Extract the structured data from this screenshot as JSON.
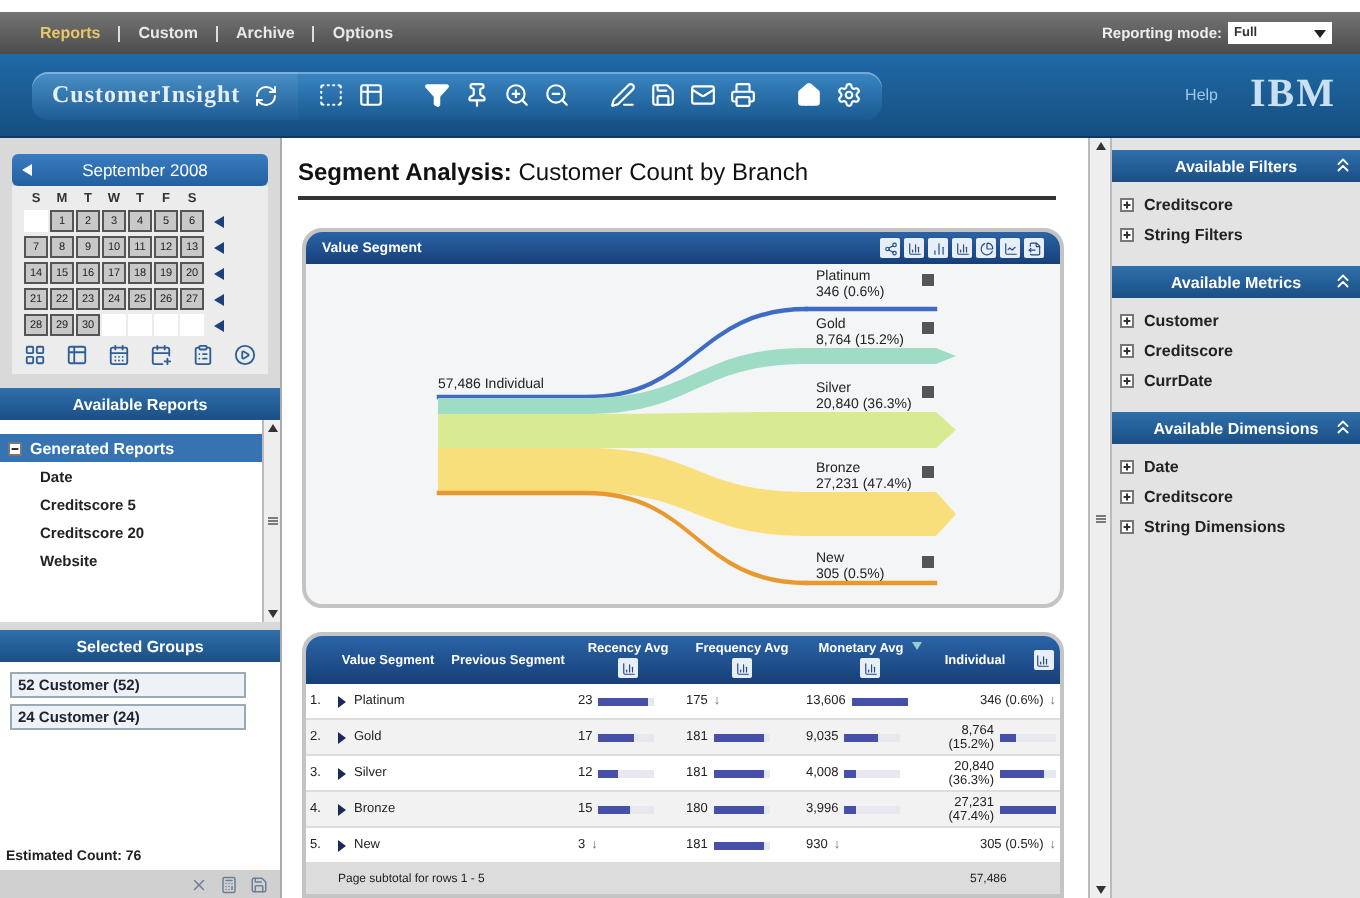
{
  "top_nav": {
    "items": [
      {
        "label": "Reports",
        "selected": true
      },
      {
        "label": "Custom",
        "selected": false
      },
      {
        "label": "Archive",
        "selected": false
      },
      {
        "label": "Options",
        "selected": false
      }
    ],
    "reporting_mode": {
      "label": "Reporting mode:",
      "value": "Full"
    }
  },
  "toolbar": {
    "app_name": "CustomerInsight",
    "help": "Help",
    "logo": "IBM"
  },
  "calendar": {
    "month": "September 2008",
    "weekdays": [
      "S",
      "M",
      "T",
      "W",
      "T",
      "F",
      "S"
    ],
    "weeks": [
      [
        "1",
        "2",
        "3",
        "4",
        "5",
        "6"
      ],
      [
        "7",
        "8",
        "9",
        "10",
        "11",
        "12",
        "13"
      ],
      [
        "14",
        "15",
        "16",
        "17",
        "18",
        "19",
        "20"
      ],
      [
        "21",
        "22",
        "23",
        "24",
        "25",
        "26",
        "27"
      ],
      [
        "28",
        "29",
        "30"
      ]
    ]
  },
  "available_reports": {
    "title": "Available Reports",
    "group": {
      "label": "Generated Reports",
      "expanded": true,
      "items": [
        "Date",
        "Creditscore 5",
        "Creditscore 20",
        "Website"
      ]
    }
  },
  "selected_groups": {
    "title": "Selected Groups",
    "items": [
      "52 Customer (52)",
      "24 Customer (24)"
    ],
    "estimated_count": "Estimated Count: 76"
  },
  "main": {
    "title": "**Segment Analysis:** Customer Count by Branch"
  },
  "segment_chart": {
    "title": "Value Segment",
    "root": "57,486 Individual",
    "branches": [
      {
        "name": "Platinum",
        "value": "346 (0.6%)",
        "color": "#3e6cc4"
      },
      {
        "name": "Gold",
        "value": "8,764 (15.2%)",
        "color": "#9edcc6"
      },
      {
        "name": "Silver",
        "value": "20,840 (36.3%)",
        "color": "#d9eb92"
      },
      {
        "name": "Bronze",
        "value": "27,231 (47.4%)",
        "color": "#f9df7c"
      },
      {
        "name": "New",
        "value": "305 (0.5%)",
        "color": "#e8982c"
      }
    ]
  },
  "table": {
    "columns": [
      "Value Segment",
      "Previous Segment",
      "Recency Avg",
      "Frequency Avg",
      "Monetary Avg",
      "Individual"
    ],
    "rows": [
      {
        "index": "1.",
        "segment": "Platinum",
        "recency": {
          "value": "23",
          "level": 0.9
        },
        "frequency": {
          "value": "175",
          "trend": "↓"
        },
        "monetary": {
          "value": "13,606",
          "level": 1
        },
        "individual": {
          "value": "346 (0.6%)",
          "trend": "↓"
        }
      },
      {
        "index": "2.",
        "segment": "Gold",
        "recency": {
          "value": "17",
          "level": 0.65
        },
        "frequency": {
          "value": "181",
          "level": 0.9
        },
        "monetary": {
          "value": "9,035",
          "level": 0.6
        },
        "individual": {
          "value": "8,764 (15.2%)",
          "level": 0.3
        }
      },
      {
        "index": "3.",
        "segment": "Silver",
        "recency": {
          "value": "12",
          "level": 0.35
        },
        "frequency": {
          "value": "181",
          "level": 0.9
        },
        "monetary": {
          "value": "4,008",
          "level": 0.2
        },
        "individual": {
          "value": "20,840 (36.3%)",
          "level": 0.8
        }
      },
      {
        "index": "4.",
        "segment": "Bronze",
        "recency": {
          "value": "15",
          "level": 0.55
        },
        "frequency": {
          "value": "180",
          "level": 0.9
        },
        "monetary": {
          "value": "3,996",
          "level": 0.2
        },
        "individual": {
          "value": "27,231 (47.4%)",
          "level": 1
        }
      },
      {
        "index": "5.",
        "segment": "New",
        "recency": {
          "value": "3",
          "trend": "↓"
        },
        "frequency": {
          "value": "181",
          "level": 0.9
        },
        "monetary": {
          "value": "930",
          "trend": "↓"
        },
        "individual": {
          "value": "305 (0.5%)",
          "trend": "↓"
        }
      }
    ],
    "subtotal": {
      "label": "Page subtotal for rows 1 - 5",
      "individual": "57,486"
    }
  },
  "right_panel": {
    "sections": [
      {
        "title": "Available Filters",
        "items": [
          {
            "label": "Creditscore",
            "expanded": false
          },
          {
            "label": "String Filters",
            "expanded": false
          }
        ]
      },
      {
        "title": "Available Metrics",
        "items": [
          {
            "label": "Customer",
            "expanded": false
          },
          {
            "label": "Creditscore",
            "expanded": false
          },
          {
            "label": "CurrDate",
            "expanded": false
          }
        ]
      },
      {
        "title": "Available Dimensions",
        "items": [
          {
            "label": "Date",
            "expanded": false
          },
          {
            "label": "Creditscore",
            "expanded": false
          },
          {
            "label": "String Dimensions",
            "expanded": false
          }
        ]
      }
    ]
  }
}
